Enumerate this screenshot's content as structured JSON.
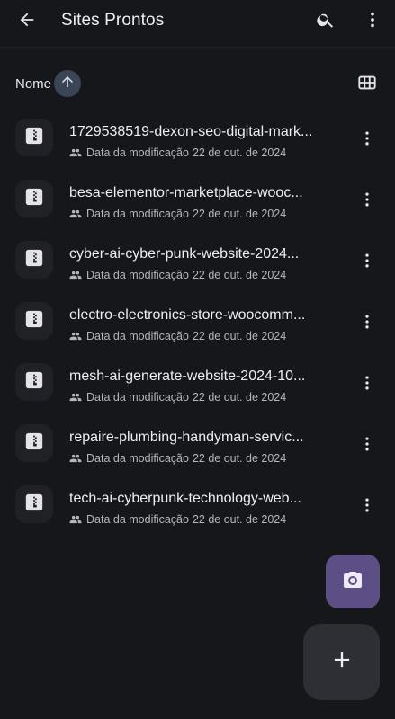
{
  "header": {
    "title": "Sites Prontos",
    "back_icon": "arrow-left-icon",
    "search_icon": "search-icon",
    "more_icon": "more-vert-icon"
  },
  "sort": {
    "label": "Nome",
    "direction": "ascending",
    "direction_icon": "arrow-up-icon",
    "view_toggle_icon": "grid-view-icon"
  },
  "files": [
    {
      "name": "1729538519-dexon-seo-digital-mark...",
      "meta_label": "Data da modificação",
      "date": "22 de out. de 2024",
      "icon": "zip-file-icon"
    },
    {
      "name": "besa-elementor-marketplace-wooc...",
      "meta_label": "Data da modificação",
      "date": "22 de out. de 2024",
      "icon": "zip-file-icon"
    },
    {
      "name": "cyber-ai-cyber-punk-website-2024...",
      "meta_label": "Data da modificação",
      "date": "22 de out. de 2024",
      "icon": "zip-file-icon"
    },
    {
      "name": "electro-electronics-store-woocomm...",
      "meta_label": "Data da modificação",
      "date": "22 de out. de 2024",
      "icon": "zip-file-icon"
    },
    {
      "name": "mesh-ai-generate-website-2024-10...",
      "meta_label": "Data da modificação",
      "date": "22 de out. de 2024",
      "icon": "zip-file-icon"
    },
    {
      "name": "repaire-plumbing-handyman-servic...",
      "meta_label": "Data da modificação",
      "date": "22 de out. de 2024",
      "icon": "zip-file-icon"
    },
    {
      "name": "tech-ai-cyberpunk-technology-web...",
      "meta_label": "Data da modificação",
      "date": "22 de out. de 2024",
      "icon": "zip-file-icon"
    }
  ],
  "fabs": {
    "scan_icon": "camera-icon",
    "add_icon": "plus-icon"
  },
  "colors": {
    "background": "#16171b",
    "camera_fab": "#5d4f86",
    "add_fab": "#2d2f35",
    "sort_chip": "#3a4656"
  }
}
